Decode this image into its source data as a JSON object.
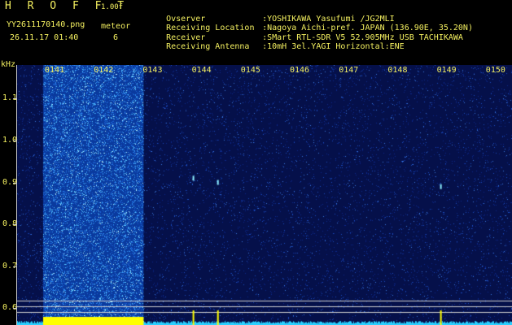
{
  "header": {
    "app_title": "H R O F F T",
    "version": "1.00f",
    "filename": "YY2611170140.png",
    "meteor_label": "meteor",
    "meteor_count": "6",
    "datetime": "26.11.17 01:40",
    "info": [
      {
        "label": "Ovserver",
        "value": ":YOSHIKAWA Yasufumi /JG2MLI"
      },
      {
        "label": "Receiving Location",
        "value": ":Nagoya Aichi-pref. JAPAN (136.90E, 35.20N)"
      },
      {
        "label": "Receiver",
        "value": ":SMart RTL-SDR V5 52.905MHz USB TACHIKAWA"
      },
      {
        "label": "Receiving Antenna",
        "value": ":10mH 3el.YAGI Horizontal:ENE"
      }
    ]
  },
  "chart_data": {
    "type": "heatmap",
    "y_unit_label": "kHz",
    "y_ticks": [
      "1.1",
      "1.0",
      "0.9",
      "0.8",
      "0.7",
      "0.6"
    ],
    "y_values": [
      1.1,
      1.0,
      0.9,
      0.8,
      0.7,
      0.6
    ],
    "ylim": [
      0.56,
      1.18
    ],
    "x_ticks": [
      "0141",
      "0142",
      "0143",
      "0144",
      "0145",
      "0146",
      "0147",
      "0148",
      "0149",
      "0150"
    ],
    "xlim_minutes": [
      0,
      10
    ],
    "background_color": "#05104a",
    "noise_band_minutes": [
      0.0,
      2.05
    ],
    "meteor_traces": [
      {
        "minute": 3.05,
        "freq": 0.91
      },
      {
        "minute": 3.55,
        "freq": 0.9
      },
      {
        "minute": 8.1,
        "freq": 0.89
      }
    ],
    "colors": {
      "signal": "#ffff00",
      "noise": "#33a8ff",
      "reference_line": "#cfcfcf"
    }
  }
}
